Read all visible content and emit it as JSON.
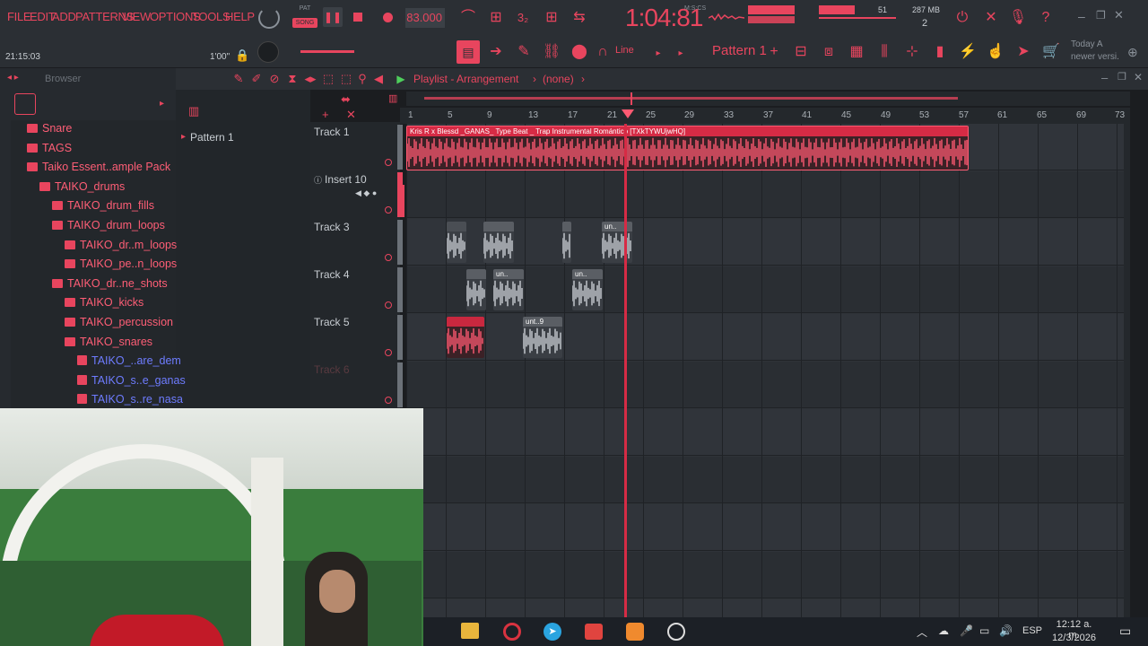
{
  "menu": [
    "FILE",
    "EDIT",
    "ADD",
    "PATTERNS",
    "VIEW",
    "OPTIONS",
    "TOOLS",
    "HELP"
  ],
  "transport": {
    "pat_label": "PAT",
    "song_label": "SONG",
    "tempo": "83.000",
    "time": "1:04:81",
    "time_unit": "M:S:CS",
    "elapsed": "21:15:03",
    "snap_value": "1'00\""
  },
  "cpu": {
    "value": "51",
    "memory": "287 MB",
    "voices": "2"
  },
  "snap": {
    "mode": "Line"
  },
  "pattern_selector": {
    "label": "Pattern 1"
  },
  "news": {
    "line1": "Today  A",
    "line2": "newer versi."
  },
  "browser": {
    "title": "Browser",
    "items": [
      {
        "label": "Snare",
        "level": 1
      },
      {
        "label": "TAGS",
        "level": 1
      },
      {
        "label": "Taiko Essent..ample Pack",
        "level": 1
      },
      {
        "label": "TAIKO_drums",
        "level": 2
      },
      {
        "label": "TAIKO_drum_fills",
        "level": 3
      },
      {
        "label": "TAIKO_drum_loops",
        "level": 3
      },
      {
        "label": "TAIKO_dr..m_loops",
        "level": 4
      },
      {
        "label": "TAIKO_pe..n_loops",
        "level": 4
      },
      {
        "label": "TAIKO_dr..ne_shots",
        "level": 3
      },
      {
        "label": "TAIKO_kicks",
        "level": 4
      },
      {
        "label": "TAIKO_percussion",
        "level": 4
      },
      {
        "label": "TAIKO_snares",
        "level": 4
      },
      {
        "label": "TAIKO_..are_dem",
        "level": 5,
        "file": true
      },
      {
        "label": "TAIKO_s..e_ganas",
        "level": 5,
        "file": true
      },
      {
        "label": "TAIKO_s..re_nasa",
        "level": 5,
        "file": true
      }
    ]
  },
  "playlist": {
    "title": "Playlist - Arrangement",
    "arrangement": "(none)",
    "pattern_item": "Pattern 1",
    "tracks": [
      "Track 1",
      "Insert 10",
      "Track 3",
      "Track 4",
      "Track 5",
      "Track 6"
    ],
    "ruler": [
      "1",
      "5",
      "9",
      "13",
      "17",
      "21",
      "25",
      "29",
      "33",
      "37",
      "41",
      "45",
      "49",
      "53",
      "57",
      "61",
      "65",
      "69",
      "73"
    ],
    "main_clip_title": "Kris R x Blessd _GANAS_ Type Beat _ Trap Instrumental Romántico [TXkTYWUjwHQ]"
  },
  "clips": {
    "t3": [
      "",
      "",
      " ",
      "un.."
    ],
    "t4": [
      "",
      "un..",
      "un.."
    ],
    "t5": [
      "",
      "unt..9"
    ]
  },
  "taskbar": {
    "lang": "ESP",
    "time": "12:12 a. m.",
    "date": "12/3/2026"
  },
  "colors": {
    "accent": "#e8455e",
    "clip_red": "#ff5a72",
    "clip_grey": "#c9ced3",
    "bg": "#1b1d20"
  }
}
